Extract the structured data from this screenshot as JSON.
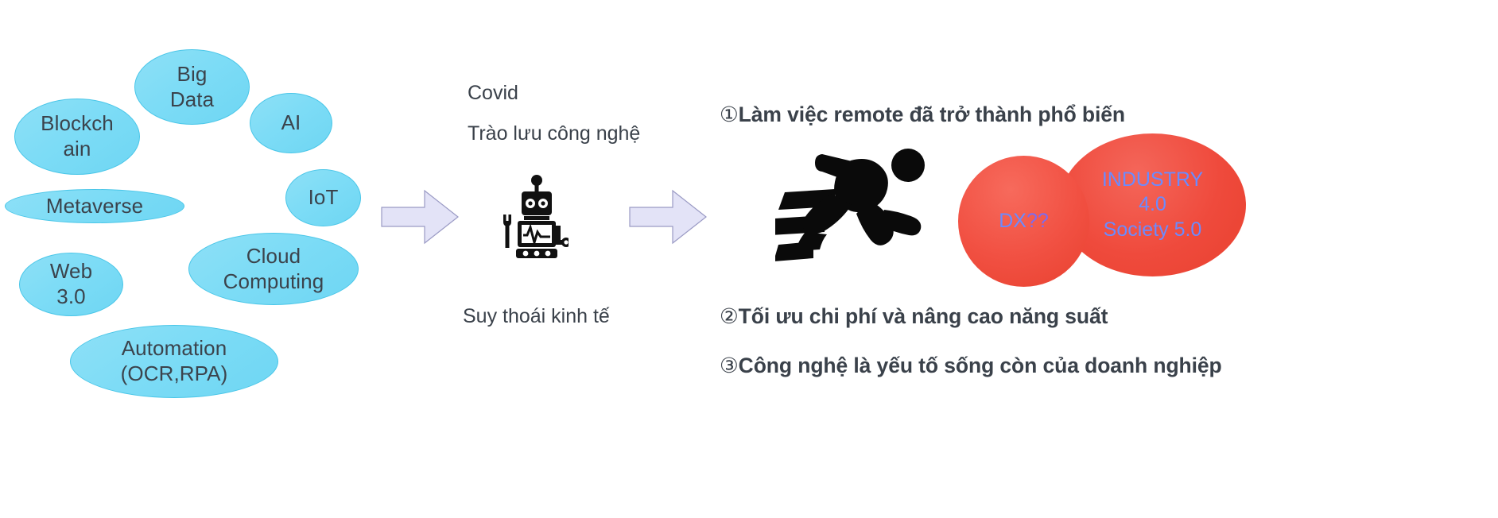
{
  "left_cluster": {
    "title": "technology trends",
    "bubble_color": "#7ddcf6",
    "bubbles": [
      {
        "id": "blockchain",
        "label": "Blockch\nain"
      },
      {
        "id": "big-data",
        "label": "Big\nData"
      },
      {
        "id": "ai",
        "label": "AI"
      },
      {
        "id": "metaverse",
        "label": "Metaverse"
      },
      {
        "id": "iot",
        "label": "IoT"
      },
      {
        "id": "web30",
        "label": "Web\n3.0"
      },
      {
        "id": "cloud",
        "label": "Cloud\nComputing"
      },
      {
        "id": "automation",
        "label": "Automation\n(OCR,RPA)"
      }
    ]
  },
  "arrows": {
    "icon": "right-arrow-icon",
    "fill": "#e3e3f7",
    "stroke": "#9a9ac4",
    "count": 2
  },
  "middle": {
    "line1": "Covid",
    "line2": "Trào lưu công nghệ",
    "line3": "Suy thoái kinh tế",
    "robot_icon": "robot-icon"
  },
  "right": {
    "runner_icon": "running-person-icon",
    "points": [
      {
        "marker": "①",
        "text": "Làm việc remote đã trở thành phổ biến"
      },
      {
        "marker": "②",
        "text": "Tối ưu chi phí và nâng cao năng suất"
      },
      {
        "marker": "③",
        "text": "Công nghệ là yếu tố sống còn của doanh nghiệp"
      }
    ],
    "circles": [
      {
        "id": "dx",
        "label": "DX",
        "marks": "??",
        "color": "#ef4a3c",
        "text_color": "#6a8bff"
      },
      {
        "id": "industry",
        "label": "INDUSTRY\n4.0\nSociety 5.0",
        "color": "#ef4a3c",
        "text_color": "#6a8bff"
      }
    ]
  }
}
